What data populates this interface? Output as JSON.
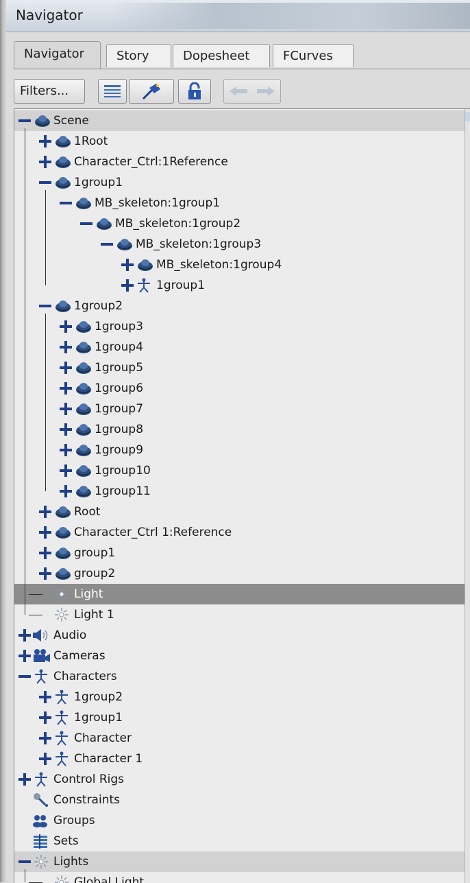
{
  "window": {
    "title": "Navigator"
  },
  "tabs": [
    {
      "label": "Navigator",
      "active": true
    },
    {
      "label": "Story",
      "active": false
    },
    {
      "label": "Dopesheet",
      "active": false
    },
    {
      "label": "FCurves",
      "active": false
    }
  ],
  "toolbar": {
    "filters_label": "Filters...",
    "buttons": [
      "list-view-icon",
      "pin-icon",
      "lock-icon",
      "back-arrow-icon",
      "forward-arrow-icon"
    ]
  },
  "colors": {
    "expander": "#1f3f8a",
    "model_icon": "#2e4f7e",
    "selection": "#8c8c8c"
  },
  "tree": [
    {
      "label": "Scene",
      "depth": 0,
      "expander": "minus",
      "icon": "model-icon",
      "header": true
    },
    {
      "label": "1Root",
      "depth": 1,
      "expander": "plus",
      "icon": "model-icon"
    },
    {
      "label": "Character_Ctrl:1Reference",
      "depth": 1,
      "expander": "plus",
      "icon": "model-icon"
    },
    {
      "label": "1group1",
      "depth": 1,
      "expander": "minus",
      "icon": "model-icon"
    },
    {
      "label": "MB_skeleton:1group1",
      "depth": 2,
      "expander": "minus",
      "icon": "model-icon"
    },
    {
      "label": "MB_skeleton:1group2",
      "depth": 3,
      "expander": "minus",
      "icon": "model-icon"
    },
    {
      "label": "MB_skeleton:1group3",
      "depth": 4,
      "expander": "minus",
      "icon": "model-icon"
    },
    {
      "label": "MB_skeleton:1group4",
      "depth": 5,
      "expander": "plus",
      "icon": "model-icon"
    },
    {
      "label": "1group1",
      "depth": 5,
      "expander": "plus",
      "icon": "character-icon"
    },
    {
      "label": "1group2",
      "depth": 1,
      "expander": "minus",
      "icon": "model-icon"
    },
    {
      "label": "1group3",
      "depth": 2,
      "expander": "plus",
      "icon": "model-icon"
    },
    {
      "label": "1group4",
      "depth": 2,
      "expander": "plus",
      "icon": "model-icon"
    },
    {
      "label": "1group5",
      "depth": 2,
      "expander": "plus",
      "icon": "model-icon"
    },
    {
      "label": "1group6",
      "depth": 2,
      "expander": "plus",
      "icon": "model-icon"
    },
    {
      "label": "1group7",
      "depth": 2,
      "expander": "plus",
      "icon": "model-icon"
    },
    {
      "label": "1group8",
      "depth": 2,
      "expander": "plus",
      "icon": "model-icon"
    },
    {
      "label": "1group9",
      "depth": 2,
      "expander": "plus",
      "icon": "model-icon"
    },
    {
      "label": "1group10",
      "depth": 2,
      "expander": "plus",
      "icon": "model-icon"
    },
    {
      "label": "1group11",
      "depth": 2,
      "expander": "plus",
      "icon": "model-icon"
    },
    {
      "label": "Root",
      "depth": 1,
      "expander": "plus",
      "icon": "model-icon"
    },
    {
      "label": "Character_Ctrl 1:Reference",
      "depth": 1,
      "expander": "plus",
      "icon": "model-icon"
    },
    {
      "label": "group1",
      "depth": 1,
      "expander": "plus",
      "icon": "model-icon"
    },
    {
      "label": "group2",
      "depth": 1,
      "expander": "plus",
      "icon": "model-icon"
    },
    {
      "label": "Light",
      "depth": 1,
      "expander": "branch",
      "icon": "light-icon",
      "selected": true
    },
    {
      "label": "Light 1",
      "depth": 1,
      "expander": "branch-end",
      "icon": "light-icon"
    },
    {
      "label": "Audio",
      "depth": 0,
      "expander": "plus",
      "icon": "audio-icon"
    },
    {
      "label": "Cameras",
      "depth": 0,
      "expander": "plus",
      "icon": "camera-icon"
    },
    {
      "label": "Characters",
      "depth": 0,
      "expander": "minus",
      "icon": "character-icon"
    },
    {
      "label": "1group2",
      "depth": 1,
      "expander": "plus",
      "icon": "character-icon"
    },
    {
      "label": "1group1",
      "depth": 1,
      "expander": "plus",
      "icon": "character-icon"
    },
    {
      "label": "Character",
      "depth": 1,
      "expander": "plus",
      "icon": "character-icon"
    },
    {
      "label": "Character 1",
      "depth": 1,
      "expander": "plus",
      "icon": "character-icon"
    },
    {
      "label": "Control Rigs",
      "depth": 0,
      "expander": "plus",
      "icon": "character-icon"
    },
    {
      "label": "Constraints",
      "depth": 0,
      "expander": "none",
      "icon": "constraint-icon"
    },
    {
      "label": "Groups",
      "depth": 0,
      "expander": "none",
      "icon": "groups-icon"
    },
    {
      "label": "Sets",
      "depth": 0,
      "expander": "none",
      "icon": "sets-icon"
    },
    {
      "label": "Lights",
      "depth": 0,
      "expander": "minus",
      "icon": "light-icon",
      "header": true
    },
    {
      "label": "Global Light",
      "depth": 1,
      "expander": "branch-end",
      "icon": "light-icon"
    }
  ]
}
